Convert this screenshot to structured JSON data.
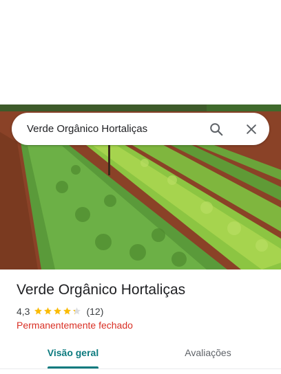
{
  "search": {
    "query": "Verde Orgânico Hortaliças",
    "search_icon": "search-icon",
    "close_icon": "close-icon"
  },
  "hero": {
    "description_icon": "photo"
  },
  "place": {
    "name": "Verde Orgânico Hortaliças",
    "rating": "4,3",
    "rating_value": 4.3,
    "reviews_count": "(12)",
    "status": "Permanentemente fechado"
  },
  "tabs": [
    {
      "label": "Visão geral",
      "active": true
    },
    {
      "label": "Avaliações",
      "active": false
    }
  ],
  "colors": {
    "accent": "#0b7a7e",
    "star": "#fbbc04",
    "status_closed": "#d93025"
  }
}
